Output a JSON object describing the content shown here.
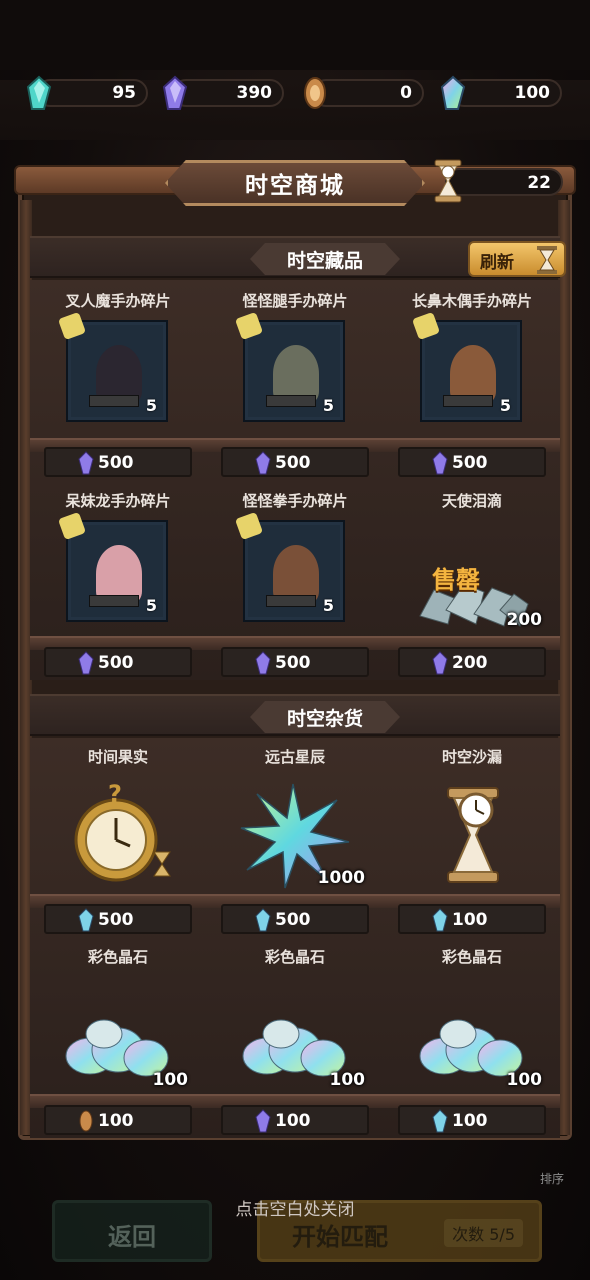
{
  "currencies": [
    {
      "name": "cyan-crystal",
      "value": "95",
      "color": "#4fd6c9"
    },
    {
      "name": "purple-crystal",
      "value": "390",
      "color": "#8f7be8"
    },
    {
      "name": "bronze-coin",
      "value": "0",
      "color": "#c98a4a"
    },
    {
      "name": "rainbow-crystal",
      "value": "100",
      "color": "#7fd3e8"
    }
  ],
  "shop": {
    "title": "时空商城",
    "hourglass_count": "22"
  },
  "collectibles": {
    "title": "时空藏品",
    "refresh_label": "刷新",
    "items": [
      {
        "name": "叉人魔手办碎片",
        "count": "5",
        "price": "500",
        "currency": "purple-crystal"
      },
      {
        "name": "怪怪腿手办碎片",
        "count": "5",
        "price": "500",
        "currency": "purple-crystal"
      },
      {
        "name": "长鼻木偶手办碎片",
        "count": "5",
        "price": "500",
        "currency": "purple-crystal"
      },
      {
        "name": "呆妹龙手办碎片",
        "count": "5",
        "price": "500",
        "currency": "purple-crystal"
      },
      {
        "name": "怪怪拳手办碎片",
        "count": "5",
        "price": "500",
        "currency": "purple-crystal"
      },
      {
        "name": "天使泪滴",
        "count": "200",
        "price": "200",
        "currency": "purple-crystal",
        "status": "售罄"
      }
    ]
  },
  "goods": {
    "title": "时空杂货",
    "items": [
      {
        "name": "时间果实",
        "count": "",
        "price": "500",
        "currency": "rainbow-crystal"
      },
      {
        "name": "远古星辰",
        "count": "1000",
        "price": "500",
        "currency": "rainbow-crystal"
      },
      {
        "name": "时空沙漏",
        "count": "",
        "price": "100",
        "currency": "rainbow-crystal"
      },
      {
        "name": "彩色晶石",
        "count": "100",
        "price": "100",
        "currency": "bronze-coin"
      },
      {
        "name": "彩色晶石",
        "count": "100",
        "price": "100",
        "currency": "purple-crystal"
      },
      {
        "name": "彩色晶石",
        "count": "100",
        "price": "100",
        "currency": "rainbow-crystal"
      }
    ]
  },
  "footer": {
    "hint": "点击空白处关闭",
    "back_label": "返回",
    "match_label": "开始匹配",
    "match_count": "次数 5/5",
    "sort_label": "排序"
  }
}
